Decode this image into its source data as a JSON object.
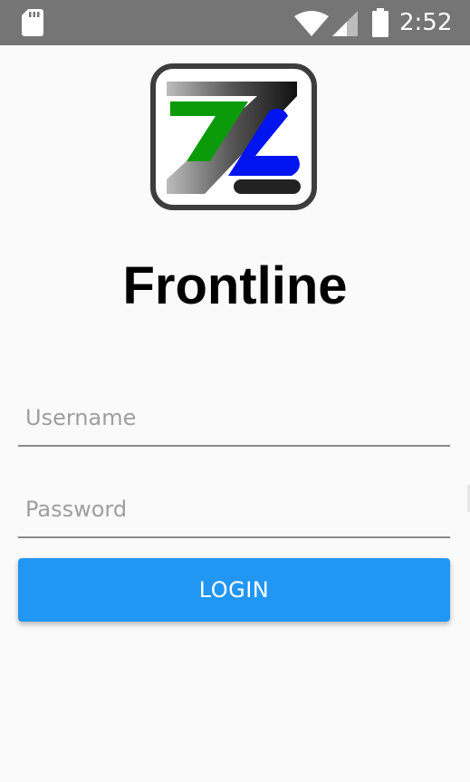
{
  "status_bar": {
    "time": "2:52",
    "icons": [
      "sd-card-icon",
      "wifi-icon",
      "signal-icon",
      "battery-icon"
    ],
    "background_color": "#757575"
  },
  "app": {
    "title": "Frontline",
    "logo_icon": "zz-logo-icon"
  },
  "form": {
    "username_placeholder": "Username",
    "password_placeholder": "Password",
    "username_value": "",
    "password_value": "",
    "login_label": "LOGIN"
  },
  "colors": {
    "accent": "#2196f3",
    "logo_green": "#0a9a0a",
    "logo_blue": "#0014f0",
    "background": "#fafafa"
  }
}
